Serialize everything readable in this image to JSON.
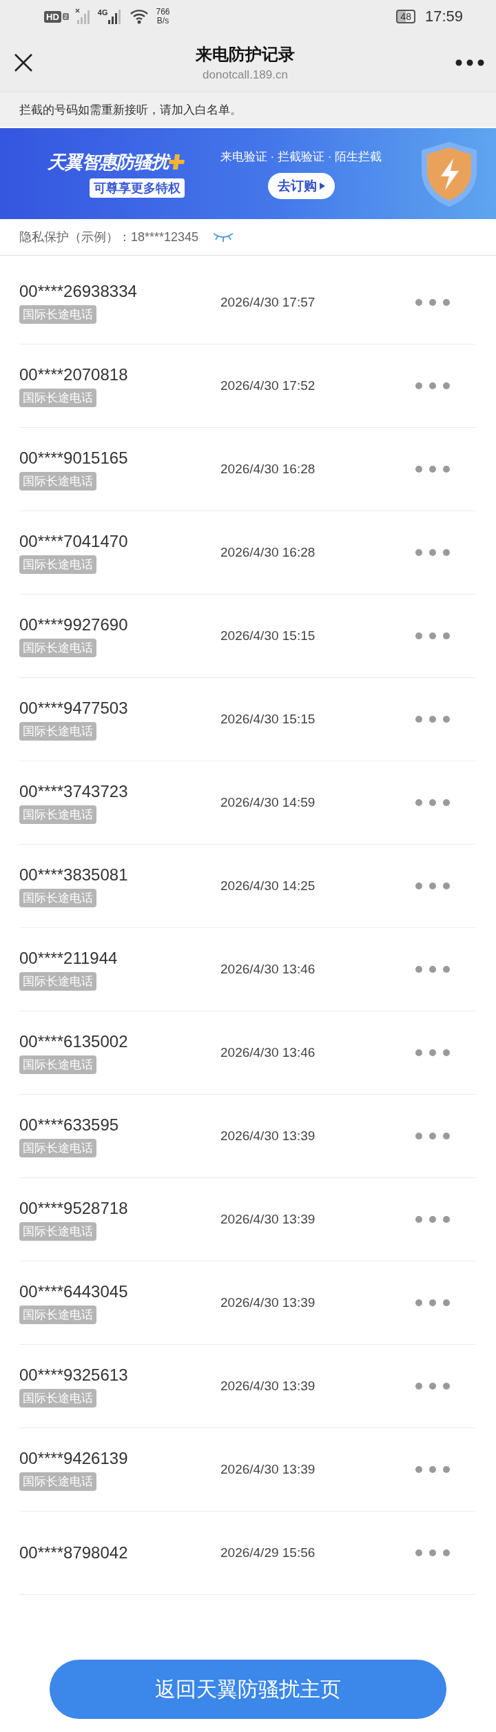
{
  "status_bar": {
    "hd": "HD",
    "sim": "2",
    "network": "4G",
    "speed_value": "766",
    "speed_unit": "B/s",
    "battery": "48",
    "time": "17:59"
  },
  "header": {
    "title": "来电防护记录",
    "subtitle": "donotcall.189.cn"
  },
  "notice": "拦截的号码如需重新接听，请加入白名单。",
  "banner": {
    "title": "天翼智惠防骚扰",
    "tagline": "可尊享更多特权",
    "features": "来电验证 · 拦截验证 · 陌生拦截",
    "button": "去订购"
  },
  "privacy": {
    "label": "隐私保护（示例）：18****12345",
    "masked": true
  },
  "records": [
    {
      "number": "00****26938334",
      "tag": "国际长途电话",
      "time": "2026/4/30 17:57"
    },
    {
      "number": "00****2070818",
      "tag": "国际长途电话",
      "time": "2026/4/30 17:52"
    },
    {
      "number": "00****9015165",
      "tag": "国际长途电话",
      "time": "2026/4/30 16:28"
    },
    {
      "number": "00****7041470",
      "tag": "国际长途电话",
      "time": "2026/4/30 16:28"
    },
    {
      "number": "00****9927690",
      "tag": "国际长途电话",
      "time": "2026/4/30 15:15"
    },
    {
      "number": "00****9477503",
      "tag": "国际长途电话",
      "time": "2026/4/30 15:15"
    },
    {
      "number": "00****3743723",
      "tag": "国际长途电话",
      "time": "2026/4/30 14:59"
    },
    {
      "number": "00****3835081",
      "tag": "国际长途电话",
      "time": "2026/4/30 14:25"
    },
    {
      "number": "00****211944",
      "tag": "国际长途电话",
      "time": "2026/4/30 13:46"
    },
    {
      "number": "00****6135002",
      "tag": "国际长途电话",
      "time": "2026/4/30 13:46"
    },
    {
      "number": "00****633595",
      "tag": "国际长途电话",
      "time": "2026/4/30 13:39"
    },
    {
      "number": "00****9528718",
      "tag": "国际长途电话",
      "time": "2026/4/30 13:39"
    },
    {
      "number": "00****6443045",
      "tag": "国际长途电话",
      "time": "2026/4/30 13:39"
    },
    {
      "number": "00****9325613",
      "tag": "国际长途电话",
      "time": "2026/4/30 13:39"
    },
    {
      "number": "00****9426139",
      "tag": "国际长途电话",
      "time": "2026/4/30 13:39"
    },
    {
      "number": "00****8798042",
      "time": "2026/4/29 15:56"
    }
  ],
  "footer_button": "返回天翼防骚扰主页"
}
